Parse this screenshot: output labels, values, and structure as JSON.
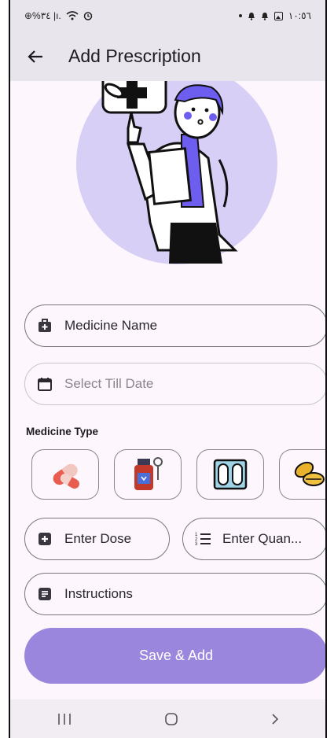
{
  "status": {
    "left": "⊕%٣٤ |ı.",
    "time": "١٠:٥٦"
  },
  "appbar": {
    "title": "Add Prescription"
  },
  "form": {
    "medicine_name": "Medicine Name",
    "till_date_placeholder": "Select Till Date",
    "section_label": "Medicine Type",
    "dose_placeholder": "Enter Dose",
    "quantity_placeholder": "Enter Quan...",
    "instructions_placeholder": "Instructions",
    "save_label": "Save & Add"
  },
  "medicine_types": [
    "capsule-icon",
    "syrup-icon",
    "blister-pack-icon",
    "tablets-icon"
  ],
  "colors": {
    "accent": "#9b86dd",
    "illustration_purple": "#d5cdf6",
    "shirt": "#6d5ef0"
  }
}
